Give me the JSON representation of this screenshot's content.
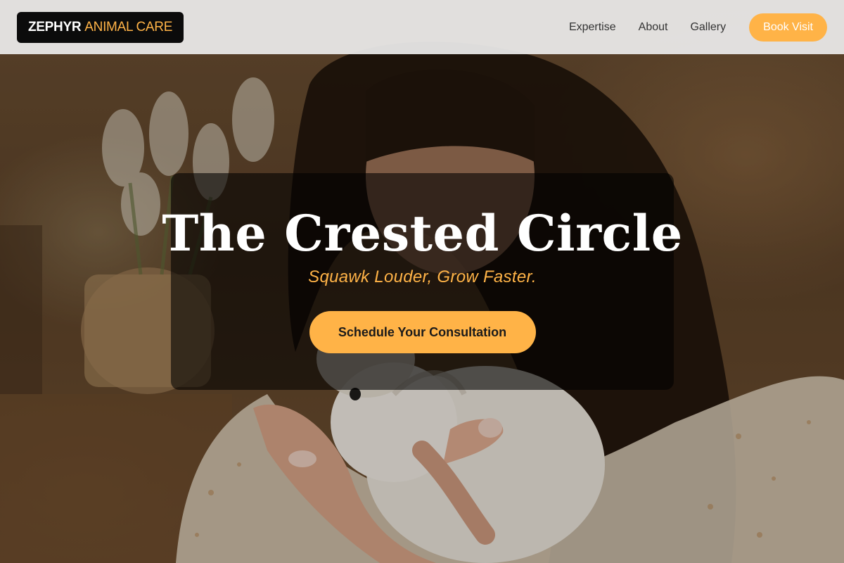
{
  "brand": {
    "name_part1": "ZEPHYR",
    "name_part2": "ANIMAL CARE"
  },
  "nav": {
    "links": [
      {
        "label": "Expertise"
      },
      {
        "label": "About"
      },
      {
        "label": "Gallery"
      }
    ],
    "cta_label": "Book Visit"
  },
  "hero": {
    "title": "The Crested Circle",
    "subtitle": "Squawk Louder, Grow Faster.",
    "cta_label": "Schedule Your Consultation",
    "background_description_icon": "photo-woman-holding-rabbit"
  },
  "colors": {
    "accent": "#ffb347",
    "header_bg": "#ececec",
    "logo_bg": "#0b0b0b",
    "card_overlay": "rgba(0,0,0,0.58)"
  }
}
